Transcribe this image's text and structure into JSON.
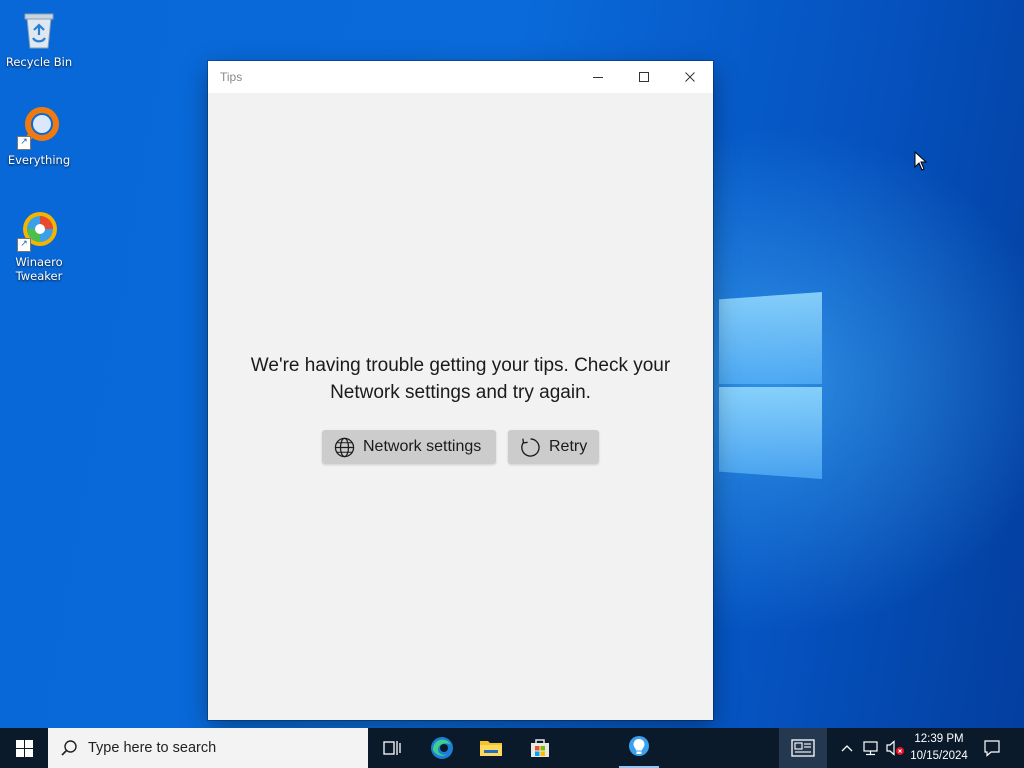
{
  "desktop": {
    "icons": [
      {
        "label": "Recycle Bin"
      },
      {
        "label": "Everything"
      },
      {
        "label": "Winaero Tweaker"
      }
    ]
  },
  "window": {
    "title": "Tips",
    "message": "We're having trouble getting your tips. Check your Network settings and try again.",
    "buttons": {
      "network_settings": "Network settings",
      "retry": "Retry"
    }
  },
  "taskbar": {
    "search_placeholder": "Type here to search",
    "apps": [
      "task-view-icon",
      "edge-icon",
      "file-explorer-icon",
      "microsoft-store-icon",
      "tips-icon"
    ],
    "clock": {
      "time": "12:39 PM",
      "date": "10/15/2024"
    }
  },
  "colors": {
    "desktop_blue": "#0868d8",
    "taskbar": "#0b1a2a",
    "window_bg": "#f2f2f2",
    "button_bg": "#cccccc"
  }
}
